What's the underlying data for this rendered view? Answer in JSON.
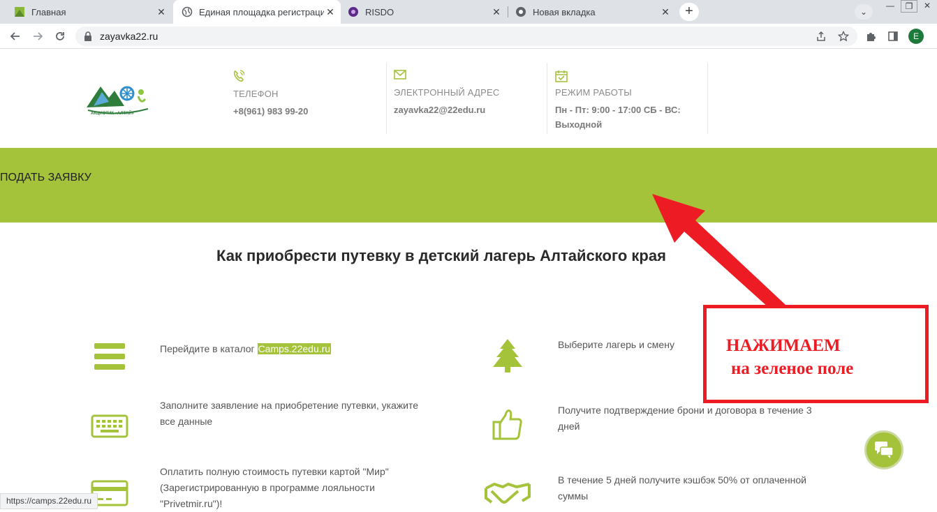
{
  "browser": {
    "tabs": [
      {
        "title": "Главная",
        "favicon": "green-square-icon"
      },
      {
        "title": "Единая площадка регистрации",
        "favicon": "globe-icon"
      },
      {
        "title": "RISDO",
        "favicon": "risdo-icon"
      },
      {
        "title": "Новая вкладка",
        "favicon": "chrome-icon"
      }
    ],
    "url": "zayavka22.ru",
    "profile_letter": "E",
    "status_url": "https://camps.22edu.ru"
  },
  "header": {
    "logo_text": "АКЦИОТИК «АЛТАЙ»",
    "phone": {
      "label": "ТЕЛЕФОН",
      "value": "+8(961) 983 99-20"
    },
    "email": {
      "label": "ЭЛЕКТРОННЫЙ АДРЕС",
      "value": "zayavka22@22edu.ru"
    },
    "hours": {
      "label": "РЕЖИМ РАБОТЫ",
      "value_line1": "Пн - Пт: 9:00 - 17:00 СБ - ВС:",
      "value_line2": "Выходной"
    }
  },
  "banner": {
    "label": "ПОДАТЬ ЗАЯВКУ",
    "color": "#a5c23b"
  },
  "section": {
    "title": "Как приобрести путевку в детский лагерь  Алтайского края"
  },
  "steps": {
    "s1": {
      "text": "Перейдите в каталог ",
      "link": "Camps.22edu.ru",
      "icon": "menu-icon"
    },
    "s2": {
      "text": "Выберите лагерь и смену",
      "icon": "tree-icon"
    },
    "s3": {
      "line1": "Заполните заявление на приобретение путевки, укажите",
      "line2": "все данные",
      "icon": "keyboard-icon"
    },
    "s4": {
      "line1": "Получите подтверждение брони и договора в течение 3",
      "line2": "дней",
      "icon": "thumbs-up-icon"
    },
    "s5": {
      "line1": "Оплатить полную стоимость путевки картой \"Мир\"",
      "line2": "(Зарегистрированную в программе лояльности",
      "line3": "\"Privetmir.ru\")!",
      "icon": "credit-card-icon"
    },
    "s6": {
      "line1": "В течение 5 дней получите кэшбэк 50% от оплаченной",
      "line2": "суммы",
      "icon": "handshake-icon"
    }
  },
  "annotation": {
    "line1": "НАЖИМАЕМ",
    "line2": "на зеленое поле",
    "color": "#ed1c24"
  }
}
